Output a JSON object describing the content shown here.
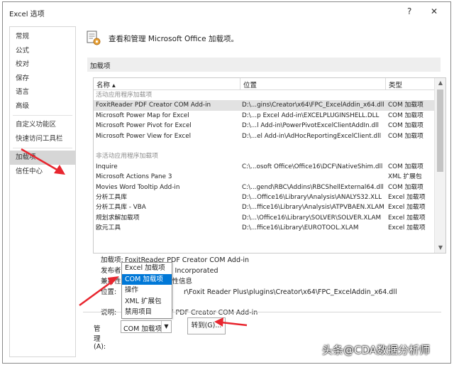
{
  "window": {
    "title": "Excel 选项",
    "help_glyph": "?",
    "close_glyph": "✕"
  },
  "sidebar": {
    "items": [
      {
        "label": "常规"
      },
      {
        "label": "公式"
      },
      {
        "label": "校对"
      },
      {
        "label": "保存"
      },
      {
        "label": "语言"
      },
      {
        "label": "高级"
      },
      {
        "label": "自定义功能区"
      },
      {
        "label": "快速访问工具栏"
      },
      {
        "label": "加载项"
      },
      {
        "label": "信任中心"
      }
    ],
    "active_index": 8
  },
  "header": {
    "text": "查看和管理 Microsoft Office 加载项。",
    "icon": "addins-gear-icon"
  },
  "section_title": "加载项",
  "table": {
    "headers": {
      "name": "名称 ▴",
      "location": "位置",
      "type": "类型"
    },
    "active_group": "活动应用程序加载项",
    "active_rows": [
      {
        "name": "FoxitReader PDF Creator COM Add-in",
        "location": "D:\\...gins\\Creator\\x64\\FPC_ExcelAddin_x64.dll",
        "type": "COM 加载项"
      },
      {
        "name": "Microsoft Power Map for Excel",
        "location": "D:\\...p Excel Add-in\\EXCELPLUGINSHELL.DLL",
        "type": "COM 加载项"
      },
      {
        "name": "Microsoft Power Pivot for Excel",
        "location": "D:\\...l Add-in\\PowerPivotExcelClientAddIn.dll",
        "type": "COM 加载项"
      },
      {
        "name": "Microsoft Power View for Excel",
        "location": "D:\\...el Add-in\\AdHocReportingExcelClient.dll",
        "type": "COM 加载项"
      }
    ],
    "inactive_group": "非活动应用程序加载项",
    "inactive_rows": [
      {
        "name": "Inquire",
        "location": "C:\\...osoft Office\\Office16\\DCF\\NativeShim.dll",
        "type": "COM 加载项"
      },
      {
        "name": "Microsoft Actions Pane 3",
        "location": "",
        "type": "XML 扩展包"
      },
      {
        "name": "Movies Word Tooltip Add-in",
        "location": "C:\\...gend\\RBC\\Addins\\RBCShellExternal64.dll",
        "type": "COM 加载项"
      },
      {
        "name": "分析工具库",
        "location": "D:\\...Office16\\Library\\Analysis\\ANALYS32.XLL",
        "type": "Excel 加载项"
      },
      {
        "name": "分析工具库 - VBA",
        "location": "D:\\...ffice16\\Library\\Analysis\\ATPVBAEN.XLAM",
        "type": "Excel 加载项"
      },
      {
        "name": "规划求解加载项",
        "location": "D:\\...\\Office16\\Library\\SOLVER\\SOLVER.XLAM",
        "type": "Excel 加载项"
      },
      {
        "name": "欧元工具",
        "location": "D:\\...ffice16\\Library\\EUROTOOL.XLAM",
        "type": "Excel 加载项"
      }
    ]
  },
  "details": {
    "addin_label": "加载项:",
    "addin_value": "FoxitReader PDF Creator COM Add-in",
    "publisher_label": "发布者:",
    "publisher_value": "Foxit Software Incorporated",
    "compat_label": "兼容性:",
    "compat_value": "没有可用的兼容性信息",
    "location_label": "位置:",
    "location_value": "r\\Foxit Reader Plus\\plugins\\Creator\\x64\\FPC_ExcelAddin_x64.dll",
    "desc_label": "说明:",
    "desc_value": "F PDF Creator COM Add-in"
  },
  "manage": {
    "label": "管理(A):",
    "selected": "COM 加载项",
    "goto_label": "转到(G)...",
    "options": [
      "Excel 加载项",
      "COM 加载项",
      "操作",
      "XML 扩展包",
      "禁用项目"
    ],
    "selected_option_index": 1
  },
  "watermark": "头条@CDA数据分析师",
  "colors": {
    "annotation_arrow": "#e8262f",
    "selection": "#0078d7"
  }
}
